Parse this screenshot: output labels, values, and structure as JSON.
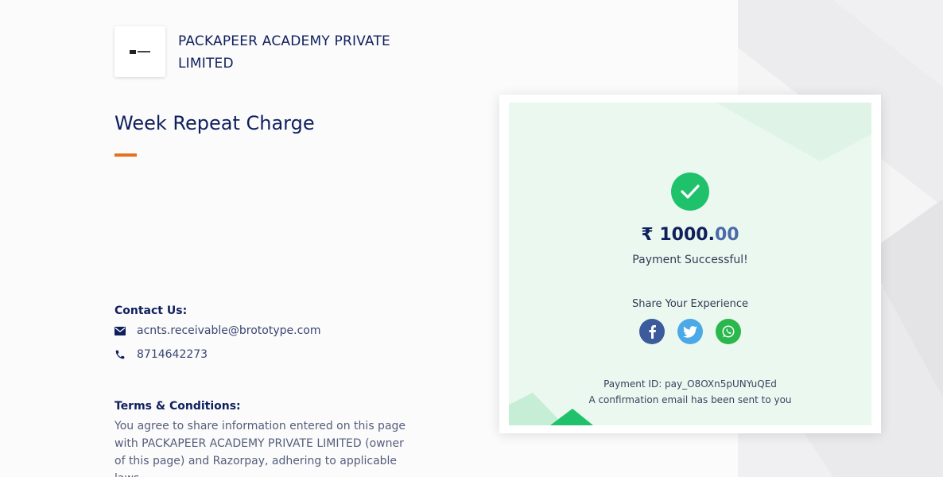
{
  "merchant": {
    "name": "PACKAPEER ACADEMY PRIVATE LIMITED",
    "logo_icon": "merchant-logo"
  },
  "page": {
    "title": "Week Repeat Charge",
    "accent_color": "#e5731e"
  },
  "contact": {
    "heading": "Contact Us:",
    "email": "acnts.receivable@brototype.com",
    "phone": "8714642273",
    "email_icon": "mail-icon",
    "phone_icon": "phone-icon"
  },
  "terms": {
    "heading": "Terms & Conditions:",
    "text": "You agree to share information entered on this page with PACKAPEER ACADEMY PRIVATE LIMITED (owner of this page) and Razorpay, adhering to applicable laws."
  },
  "result": {
    "currency": "₹",
    "amount_whole": "1000.",
    "amount_decimal": "00",
    "status": "Payment Successful!",
    "share_label": "Share Your Experience",
    "share_icons": [
      "facebook-icon",
      "twitter-icon",
      "whatsapp-icon"
    ],
    "payment_id": "Payment ID: pay_O8OXn5pUNYuQEd",
    "confirmation": "A confirmation email has been sent to you",
    "success_color": "#1fc26a"
  }
}
